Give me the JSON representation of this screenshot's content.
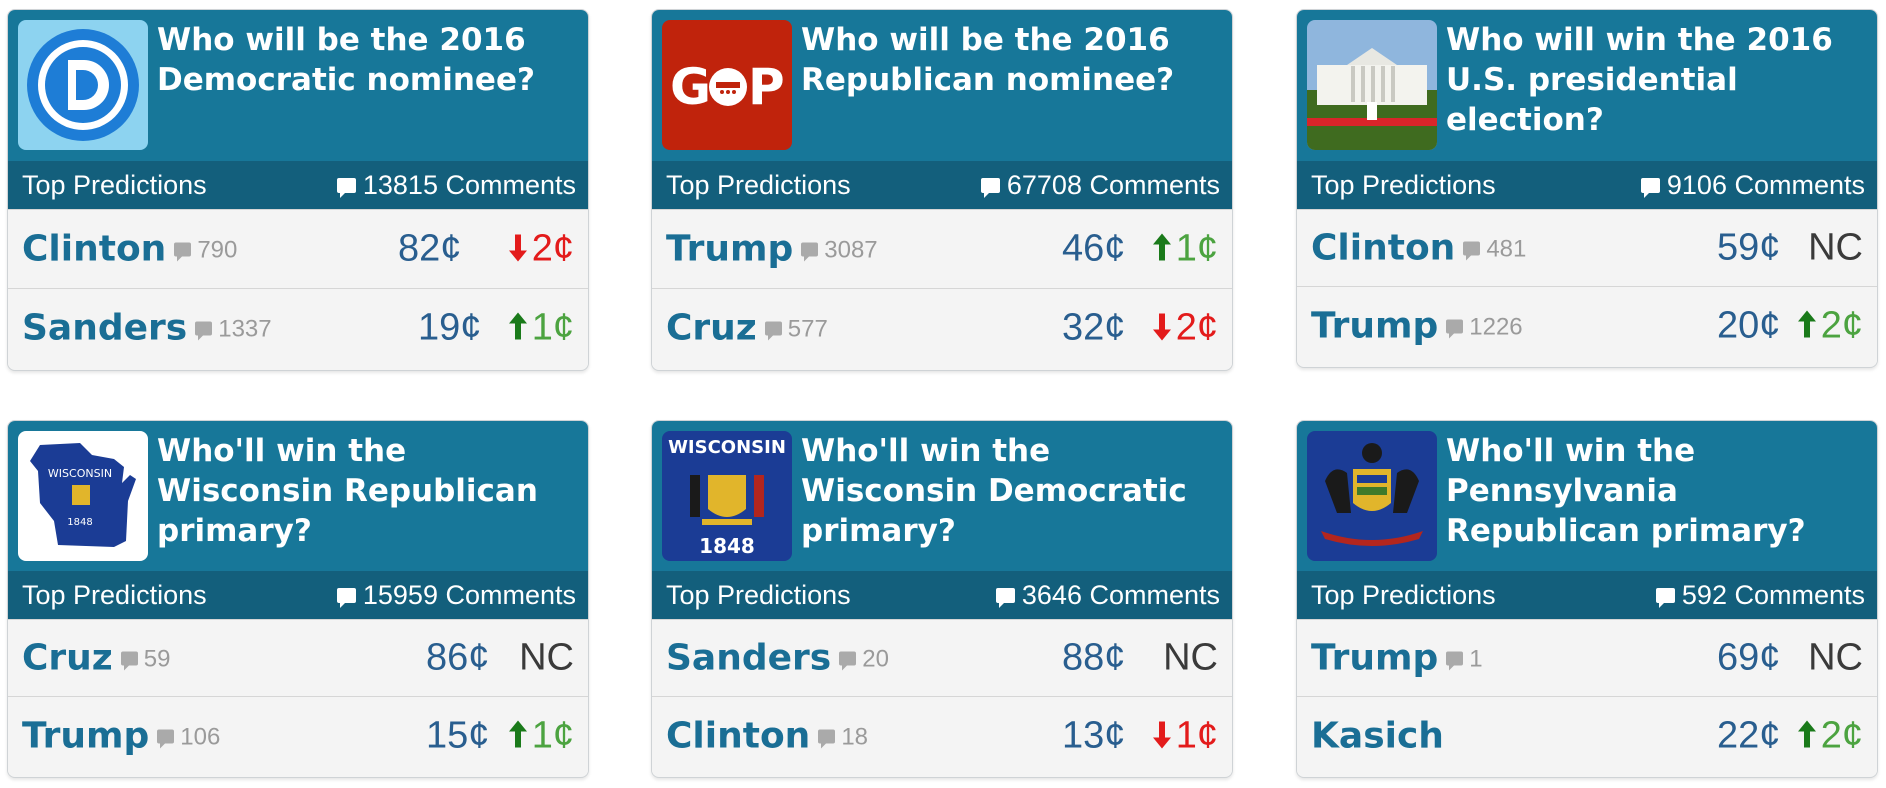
{
  "common": {
    "top_predictions_label": "Top Predictions",
    "comments_suffix": "Comments"
  },
  "colors": {
    "header": "#177799",
    "subheader": "#135f7c",
    "candidate": "#1a6e95",
    "price": "#295e8f",
    "up": "#4ca340",
    "down": "#e31b1b"
  },
  "cards": [
    {
      "title": "Who will be the 2016 Democratic nominee?",
      "image_icon": "democratic-party-logo-icon",
      "comments": "13815 Comments",
      "predictions": [
        {
          "name": "Clinton",
          "comments": "790",
          "price": "82¢",
          "direction": "down",
          "change": "2¢"
        },
        {
          "name": "Sanders",
          "comments": "1337",
          "price": "19¢",
          "direction": "up",
          "change": "1¢"
        }
      ]
    },
    {
      "title": "Who will be the 2016 Republican nominee?",
      "image_icon": "gop-logo-icon",
      "comments": "67708 Comments",
      "predictions": [
        {
          "name": "Trump",
          "comments": "3087",
          "price": "46¢",
          "direction": "up",
          "change": "1¢"
        },
        {
          "name": "Cruz",
          "comments": "577",
          "price": "32¢",
          "direction": "down",
          "change": "2¢"
        }
      ]
    },
    {
      "title": "Who will win the 2016 U.S. presidential election?",
      "image_icon": "white-house-photo-icon",
      "comments": "9106 Comments",
      "predictions": [
        {
          "name": "Clinton",
          "comments": "481",
          "price": "59¢",
          "direction": "nc",
          "change": "NC"
        },
        {
          "name": "Trump",
          "comments": "1226",
          "price": "20¢",
          "direction": "up",
          "change": "2¢"
        }
      ]
    },
    {
      "title": "Who'll win the Wisconsin Republican primary?",
      "image_icon": "wisconsin-map-icon",
      "comments": "15959 Comments",
      "predictions": [
        {
          "name": "Cruz",
          "comments": "59",
          "price": "86¢",
          "direction": "nc",
          "change": "NC"
        },
        {
          "name": "Trump",
          "comments": "106",
          "price": "15¢",
          "direction": "up",
          "change": "1¢"
        }
      ]
    },
    {
      "title": "Who'll win the Wisconsin Democratic primary?",
      "image_icon": "wisconsin-flag-icon",
      "image_text": "WISCONSIN",
      "image_year": "1848",
      "comments": "3646 Comments",
      "predictions": [
        {
          "name": "Sanders",
          "comments": "20",
          "price": "88¢",
          "direction": "nc",
          "change": "NC"
        },
        {
          "name": "Clinton",
          "comments": "18",
          "price": "13¢",
          "direction": "down",
          "change": "1¢"
        }
      ]
    },
    {
      "title": "Who'll win the Pennsylvania Republican primary?",
      "image_icon": "pennsylvania-flag-icon",
      "comments": "592 Comments",
      "predictions": [
        {
          "name": "Trump",
          "comments": "1",
          "price": "69¢",
          "direction": "nc",
          "change": "NC"
        },
        {
          "name": "Kasich",
          "comments": "",
          "price": "22¢",
          "direction": "up",
          "change": "2¢"
        }
      ]
    }
  ]
}
